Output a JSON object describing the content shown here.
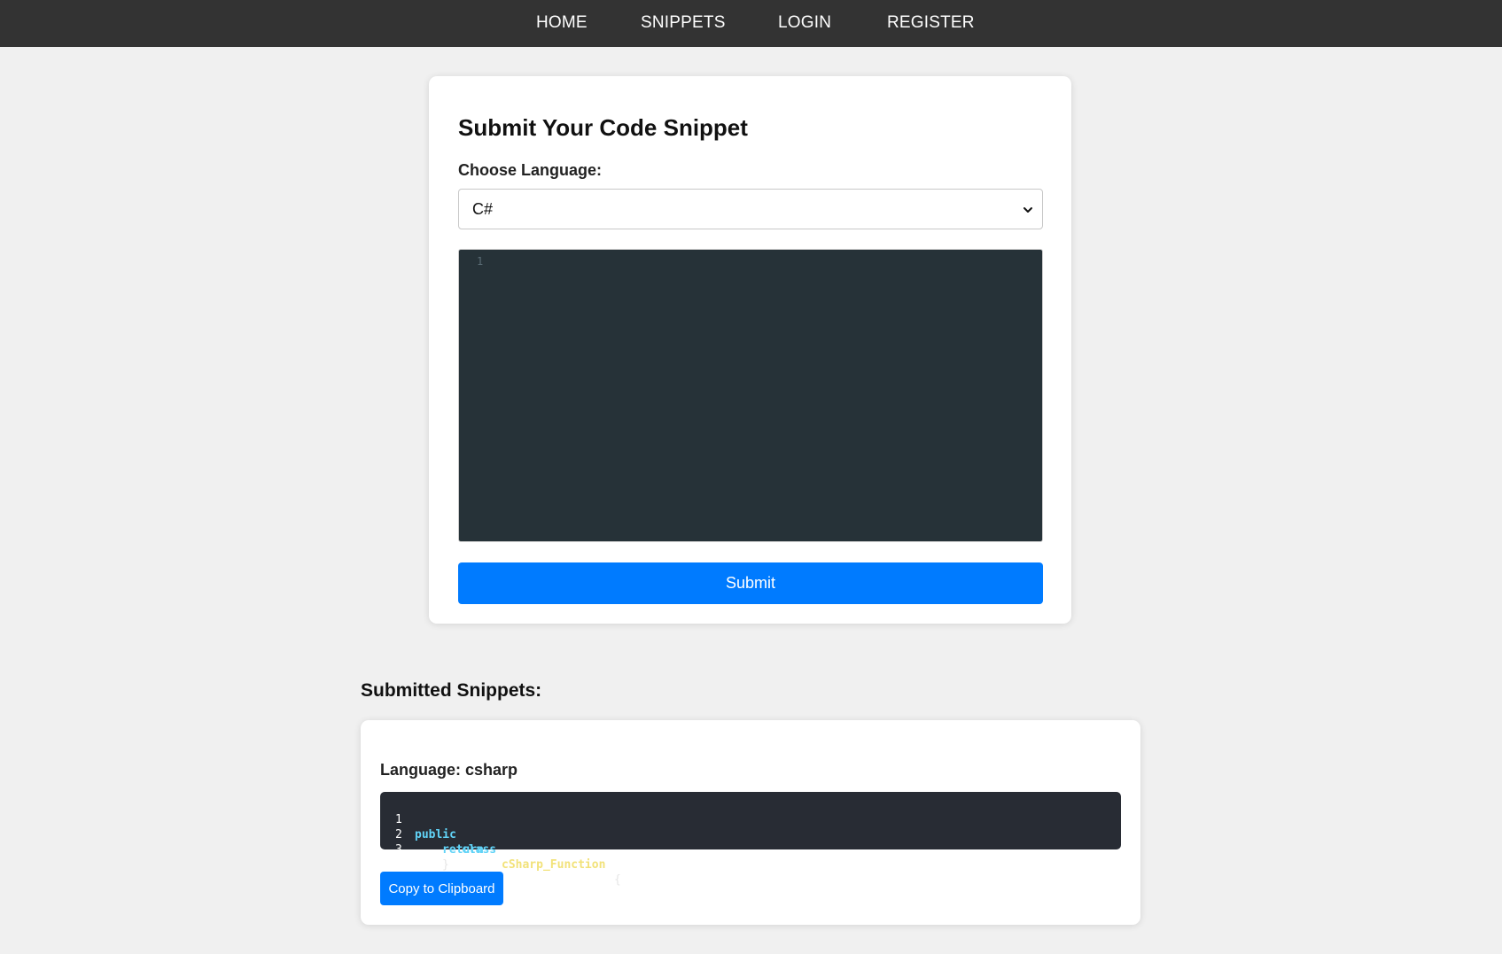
{
  "nav": {
    "items": [
      {
        "label": "HOME"
      },
      {
        "label": "SNIPPETS"
      },
      {
        "label": "LOGIN"
      },
      {
        "label": "REGISTER"
      }
    ]
  },
  "form": {
    "title": "Submit Your Code Snippet",
    "language_label": "Choose Language:",
    "language_selected": "C#",
    "editor_line_numbers": [
      "1"
    ],
    "editor_content": "",
    "submit_label": "Submit"
  },
  "submitted": {
    "heading": "Submitted Snippets:",
    "snippets": [
      {
        "language_text": "Language: csharp",
        "lines": [
          {
            "number": "1",
            "tokens": [
              "public",
              "class",
              "cSharp_Function",
              "{"
            ]
          },
          {
            "number": "2",
            "tokens": [
              "return"
            ]
          },
          {
            "number": "3",
            "tokens": [
              "}"
            ]
          }
        ],
        "copy_label": "Copy to Clipboard"
      }
    ]
  },
  "colors": {
    "navbar": "#333333",
    "page_background": "#f0f0f0",
    "primary_button": "#007bff",
    "editor_background": "#263238",
    "code_block_background": "#282c34",
    "code_keyword": "#61d3f7",
    "code_class_name": "#f2e27a"
  },
  "icons": {
    "select_chevron": "chevron-down-icon"
  }
}
